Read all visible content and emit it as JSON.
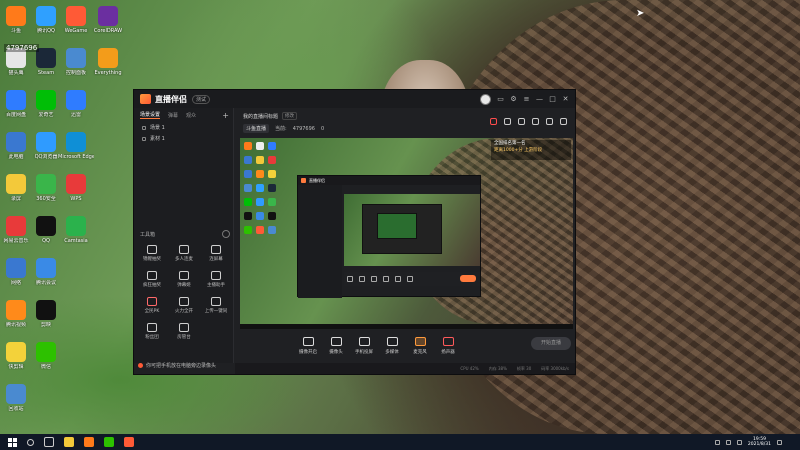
{
  "desktop": {
    "id_badge": "4797696",
    "icons": [
      {
        "label": "斗鱼",
        "color": "#ff7a1a"
      },
      {
        "label": "猫头鹰",
        "color": "#e6e6e6"
      },
      {
        "label": "百度网盘",
        "color": "#2f7cff"
      },
      {
        "label": "此电脑",
        "color": "#3a78d0"
      },
      {
        "label": "录屏",
        "color": "#f3c93a"
      },
      {
        "label": "网易云音乐",
        "color": "#e83a3a"
      },
      {
        "label": "网络",
        "color": "#3a78d0"
      },
      {
        "label": "腾讯视频",
        "color": "#ff8a1a"
      },
      {
        "label": "快剪辑",
        "color": "#f3d23a"
      },
      {
        "label": "回收站",
        "color": "#4a8ad0"
      },
      {
        "label": "腾讯QQ",
        "color": "#2fa0ff"
      },
      {
        "label": "Steam",
        "color": "#1b2838"
      },
      {
        "label": "爱奇艺",
        "color": "#00be06"
      },
      {
        "label": "QQ浏览器",
        "color": "#2f9bff"
      },
      {
        "label": "360安全",
        "color": "#3ab54a"
      },
      {
        "label": "QQ",
        "color": "#111111"
      },
      {
        "label": "腾讯会议",
        "color": "#3a8ae6"
      },
      {
        "label": "剪映",
        "color": "#111111"
      },
      {
        "label": "微信",
        "color": "#2dc100"
      },
      {
        "label": "WeGame",
        "color": "#ff5a36"
      },
      {
        "label": "控制面板",
        "color": "#4a8ad0"
      },
      {
        "label": "迅雷",
        "color": "#2f7cff"
      },
      {
        "label": "Microsoft Edge",
        "color": "#0f8fd6"
      },
      {
        "label": "WPS",
        "color": "#e83a3a"
      },
      {
        "label": "Camtasia",
        "color": "#2bb24c"
      },
      {
        "label": "CorelDRAW",
        "color": "#6b2fa0"
      },
      {
        "label": "Everything",
        "color": "#f39c1a"
      }
    ]
  },
  "app": {
    "name": "直播伴侣",
    "version_tag": "测试",
    "left_tabs": [
      "场景设置",
      "弹幕",
      "观众"
    ],
    "scenes": [
      "场景 1",
      "素材 1"
    ],
    "tools_title": "工具箱",
    "tools": [
      [
        {
          "label": "锦鲤抽奖",
          "icon": "gift-icon"
        },
        {
          "label": "多人连麦",
          "icon": "mic-icon"
        },
        {
          "label": "连屏幕",
          "icon": "screen-icon"
        }
      ],
      [
        {
          "label": "疯狂抽奖",
          "icon": "lottery-icon"
        },
        {
          "label": "弹幕姬",
          "icon": "tv-icon"
        },
        {
          "label": "主播助手",
          "icon": "calendar-icon"
        }
      ],
      [
        {
          "label": "全民PK",
          "icon": "pk-icon"
        },
        {
          "label": "火力全开",
          "icon": "fire-icon"
        },
        {
          "label": "上传一键同",
          "icon": "upload-icon"
        }
      ],
      [
        {
          "label": "粉丝团",
          "icon": "fans-icon"
        },
        {
          "label": "房管台",
          "icon": "home-icon"
        },
        {
          "label": "",
          "icon": ""
        }
      ]
    ],
    "bottom_hint": "你可把手机放在电脑旁边录像头",
    "stage_title": "我的直播间标题",
    "stage_tag": "修改",
    "category": "斗鱼直播",
    "stats": [
      "当前:",
      "4797696",
      "0"
    ],
    "rank_lines": [
      "全国排名第一名",
      "距离1000+分 上游阶段"
    ],
    "controls": [
      {
        "label": "摄像开启",
        "icon": "camera-icon"
      },
      {
        "label": "摄像头",
        "icon": "webcam-icon"
      },
      {
        "label": "手机投屏",
        "icon": "phone-icon"
      },
      {
        "label": "多媒体",
        "icon": "media-icon"
      },
      {
        "label": "麦克风",
        "icon": "mic-icon"
      },
      {
        "label": "扬声器",
        "icon": "speaker-icon"
      }
    ],
    "live_button": "开始直播",
    "status_items": [
      "CPU 42%",
      "内存 38%",
      "帧率 30",
      "码率 3000kb/s"
    ]
  },
  "taskbar": {
    "time": "19:59",
    "date": "2021/8/31"
  }
}
